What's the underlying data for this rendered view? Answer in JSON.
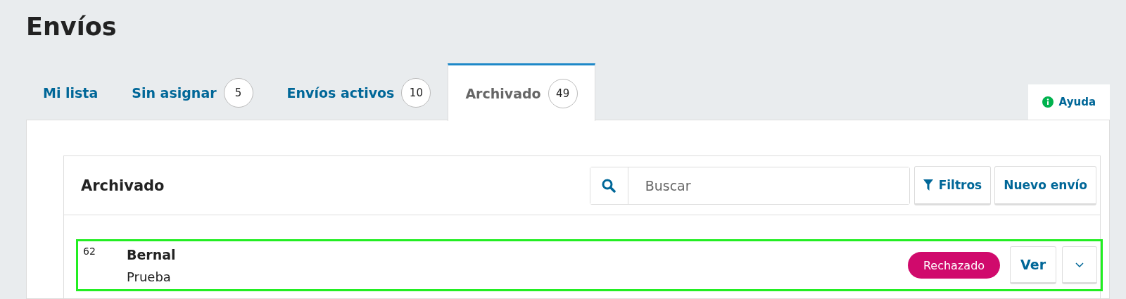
{
  "page_title": "Envíos",
  "tabs": [
    {
      "label": "Mi lista",
      "selected": false
    },
    {
      "label": "Sin asignar",
      "count": "5",
      "selected": false
    },
    {
      "label": "Envíos activos",
      "count": "10",
      "selected": false
    },
    {
      "label": "Archivado",
      "count": "49",
      "selected": true
    }
  ],
  "help_button": "Ayuda",
  "panel": {
    "title": "Archivado",
    "search": {
      "placeholder": "Buscar"
    },
    "buttons": [
      "Filtros",
      "Nuevo envío"
    ]
  },
  "submissions": [
    {
      "id": "62",
      "author": "Bernal",
      "title": "Prueba",
      "status": "Rechazado",
      "color": "#d00a6c",
      "action": "Ver",
      "highlighted": true
    }
  ]
}
